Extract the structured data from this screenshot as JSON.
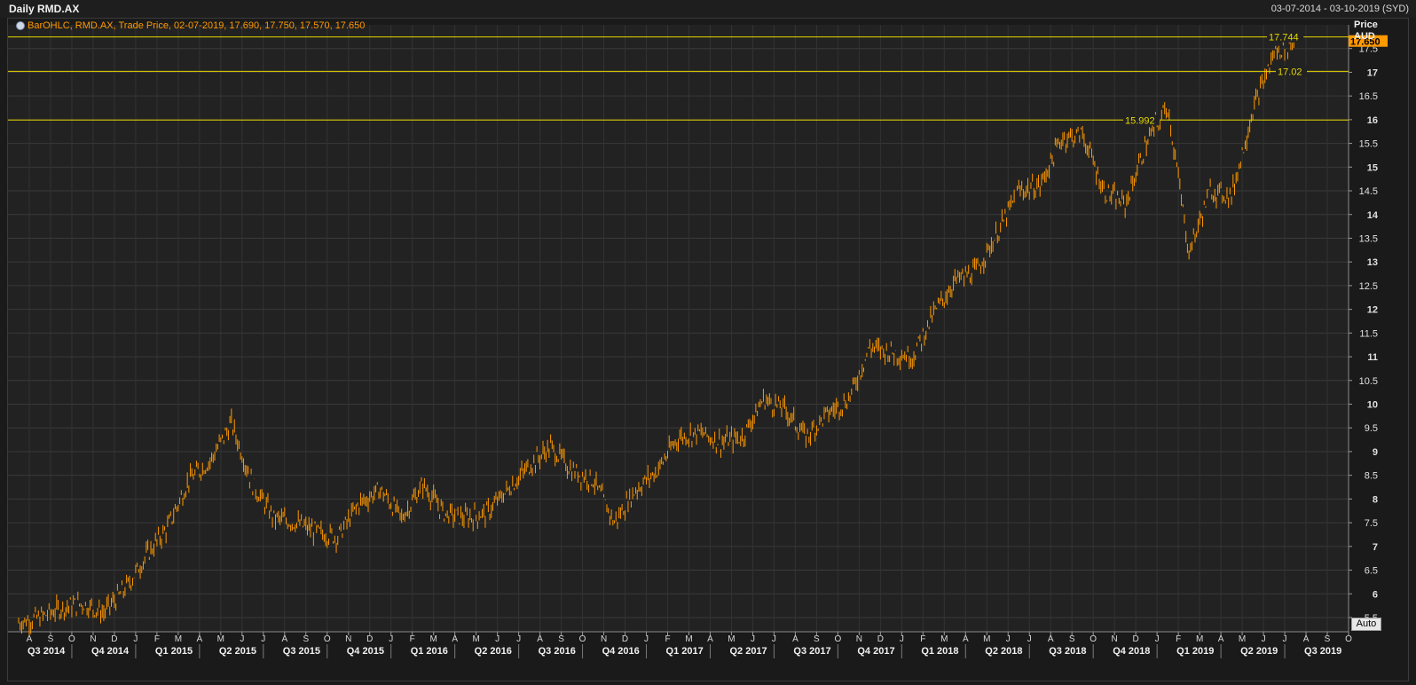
{
  "header": {
    "title": "Daily RMD.AX",
    "date_range": "03-07-2014 - 03-10-2019 (SYD)"
  },
  "legend": {
    "text": "BarOHLC, RMD.AX, Trade Price, 02-07-2019, 17.690, 17.750, 17.570, 17.650"
  },
  "price_axis": {
    "title": "Price",
    "currency": "AUD",
    "last_price_label": "17.650"
  },
  "auto_button": {
    "label": "Auto"
  },
  "colors": {
    "background": "#222222",
    "price_bars": "#ff9900",
    "hlines": "#e6d800",
    "last_price_tag": "#ff9900"
  },
  "chart_data": {
    "type": "line",
    "style": "ohlc-bars",
    "ylim": [
      5.2,
      18
    ],
    "y_ticks": [
      "5.5",
      "6",
      "6.5",
      "7",
      "7.5",
      "8",
      "8.5",
      "9",
      "9.5",
      "10",
      "10.5",
      "11",
      "11.5",
      "12",
      "12.5",
      "13",
      "13.5",
      "14",
      "14.5",
      "15",
      "15.5",
      "16",
      "16.5",
      "17",
      "17.5"
    ],
    "month_ticks": [
      "A",
      "S",
      "O",
      "N",
      "D",
      "J",
      "F",
      "M",
      "A",
      "M",
      "J",
      "J",
      "A",
      "S",
      "O",
      "N",
      "D",
      "J",
      "F",
      "M",
      "A",
      "M",
      "J",
      "J",
      "A",
      "S",
      "O",
      "N",
      "D",
      "J",
      "F",
      "M",
      "A",
      "M",
      "J",
      "J",
      "A",
      "S",
      "O",
      "N",
      "D",
      "J",
      "F",
      "M",
      "A",
      "M",
      "J",
      "J",
      "A",
      "S",
      "O",
      "N",
      "D",
      "J",
      "F",
      "M",
      "A",
      "M",
      "J",
      "J",
      "A",
      "S",
      "O"
    ],
    "quarter_labels": [
      "Q3 2014",
      "Q4 2014",
      "Q1 2015",
      "Q2 2015",
      "Q3 2015",
      "Q4 2015",
      "Q1 2016",
      "Q2 2016",
      "Q3 2016",
      "Q4 2016",
      "Q1 2017",
      "Q2 2017",
      "Q3 2017",
      "Q4 2017",
      "Q1 2018",
      "Q2 2018",
      "Q3 2018",
      "Q4 2018",
      "Q1 2019",
      "Q2 2019",
      "Q3 2019"
    ],
    "horizontal_lines": [
      {
        "value": 17.744,
        "label": "17.744"
      },
      {
        "value": 17.02,
        "label": "17.02"
      },
      {
        "value": 15.992,
        "label": "15.992"
      }
    ],
    "x_axis_months": [
      "2014-07",
      "2019-10"
    ],
    "series": [
      {
        "values": [
          [
            "2014-07",
            5.4
          ],
          [
            "2014-08",
            5.5
          ],
          [
            "2014-09",
            5.7
          ],
          [
            "2014-10",
            5.8
          ],
          [
            "2014-11",
            5.6
          ],
          [
            "2014-12",
            6.1
          ],
          [
            "2015-01",
            6.8
          ],
          [
            "2015-02",
            7.4
          ],
          [
            "2015-03",
            8.4
          ],
          [
            "2015-04",
            8.8
          ],
          [
            "2015-05",
            9.6
          ],
          [
            "2015-06",
            8.3
          ],
          [
            "2015-07",
            7.6
          ],
          [
            "2015-08",
            7.5
          ],
          [
            "2015-09",
            7.3
          ],
          [
            "2015-10",
            7.2
          ],
          [
            "2015-11",
            7.9
          ],
          [
            "2015-12",
            8.2
          ],
          [
            "2016-01",
            7.6
          ],
          [
            "2016-02",
            8.3
          ],
          [
            "2016-03",
            7.7
          ],
          [
            "2016-04",
            7.6
          ],
          [
            "2016-05",
            7.7
          ],
          [
            "2016-06",
            8.2
          ],
          [
            "2016-07",
            8.7
          ],
          [
            "2016-08",
            9.1
          ],
          [
            "2016-09",
            8.6
          ],
          [
            "2016-10",
            8.4
          ],
          [
            "2016-11",
            7.5
          ],
          [
            "2016-12",
            8.2
          ],
          [
            "2017-01",
            8.6
          ],
          [
            "2017-02",
            9.3
          ],
          [
            "2017-03",
            9.4
          ],
          [
            "2017-04",
            9.2
          ],
          [
            "2017-05",
            9.3
          ],
          [
            "2017-06",
            10.1
          ],
          [
            "2017-07",
            9.9
          ],
          [
            "2017-08",
            9.3
          ],
          [
            "2017-09",
            9.8
          ],
          [
            "2017-10",
            10.1
          ],
          [
            "2017-11",
            11.2
          ],
          [
            "2017-12",
            11.1
          ],
          [
            "2018-01",
            11.0
          ],
          [
            "2018-02",
            11.9
          ],
          [
            "2018-03",
            12.6
          ],
          [
            "2018-04",
            12.8
          ],
          [
            "2018-05",
            13.6
          ],
          [
            "2018-06",
            14.5
          ],
          [
            "2018-07",
            14.6
          ],
          [
            "2018-08",
            15.6
          ],
          [
            "2018-09",
            15.7
          ],
          [
            "2018-10",
            14.5
          ],
          [
            "2018-11",
            14.2
          ],
          [
            "2018-12",
            15.5
          ],
          [
            "2019-01",
            16.3
          ],
          [
            "2019-02",
            13.2
          ],
          [
            "2019-03",
            14.5
          ],
          [
            "2019-04",
            14.4
          ],
          [
            "2019-05",
            16.2
          ],
          [
            "2019-06",
            17.4
          ],
          [
            "2019-07",
            17.65
          ]
        ]
      }
    ]
  }
}
